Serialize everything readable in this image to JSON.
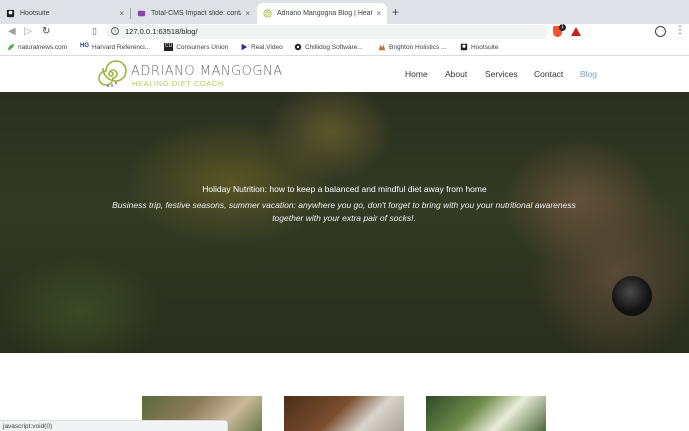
{
  "browser": {
    "tabs": [
      {
        "title": "Hootsuite",
        "active": false
      },
      {
        "title": "Total-CMS Impact slide: contai",
        "active": false
      },
      {
        "title": "Adriano Mangogna Blog | Heali",
        "active": true
      }
    ],
    "new_tab_label": "+",
    "close_glyph": "×",
    "url": "127.0.0.1:63518/blog/",
    "brave_badge": "1",
    "bookmarks": [
      {
        "label": "naturalnews.com",
        "icon": "leaf-icon"
      },
      {
        "label": "Harvard Referenci...",
        "icon": "hg-icon",
        "mark": "HG"
      },
      {
        "label": "Consumers Union",
        "icon": "cu-icon",
        "mark": "CU"
      },
      {
        "label": "Real.Video",
        "icon": "play-icon"
      },
      {
        "label": "Chillidog Software...",
        "icon": "chillidog-icon"
      },
      {
        "label": "Brighton Holistics ...",
        "icon": "brighton-icon"
      },
      {
        "label": "Hootsuite",
        "icon": "hootsuite-icon"
      }
    ],
    "status_text": "javascript:void(0)"
  },
  "site": {
    "logo_name": "ADRIANO MANGOGNA",
    "logo_tagline": "HEALING DIET COACH",
    "nav": [
      {
        "label": "Home",
        "current": false
      },
      {
        "label": "About",
        "current": false
      },
      {
        "label": "Services",
        "current": false
      },
      {
        "label": "Contact",
        "current": false
      },
      {
        "label": "Blog",
        "current": true
      }
    ],
    "hero": {
      "title": "Holiday Nutrition: how to keep a balanced and mindful diet away from home",
      "subtitle": "Business trip, festive seasons, summer vacation: anywhere you go, don't forget to bring with you your nutritional awareness together with your extra pair of socks!."
    }
  },
  "colors": {
    "tabstrip": "#dee1e6",
    "nav_current": "#7fa1b8",
    "logo_tagline": "#b9c95a",
    "logo_name": "#6b6b6b"
  }
}
